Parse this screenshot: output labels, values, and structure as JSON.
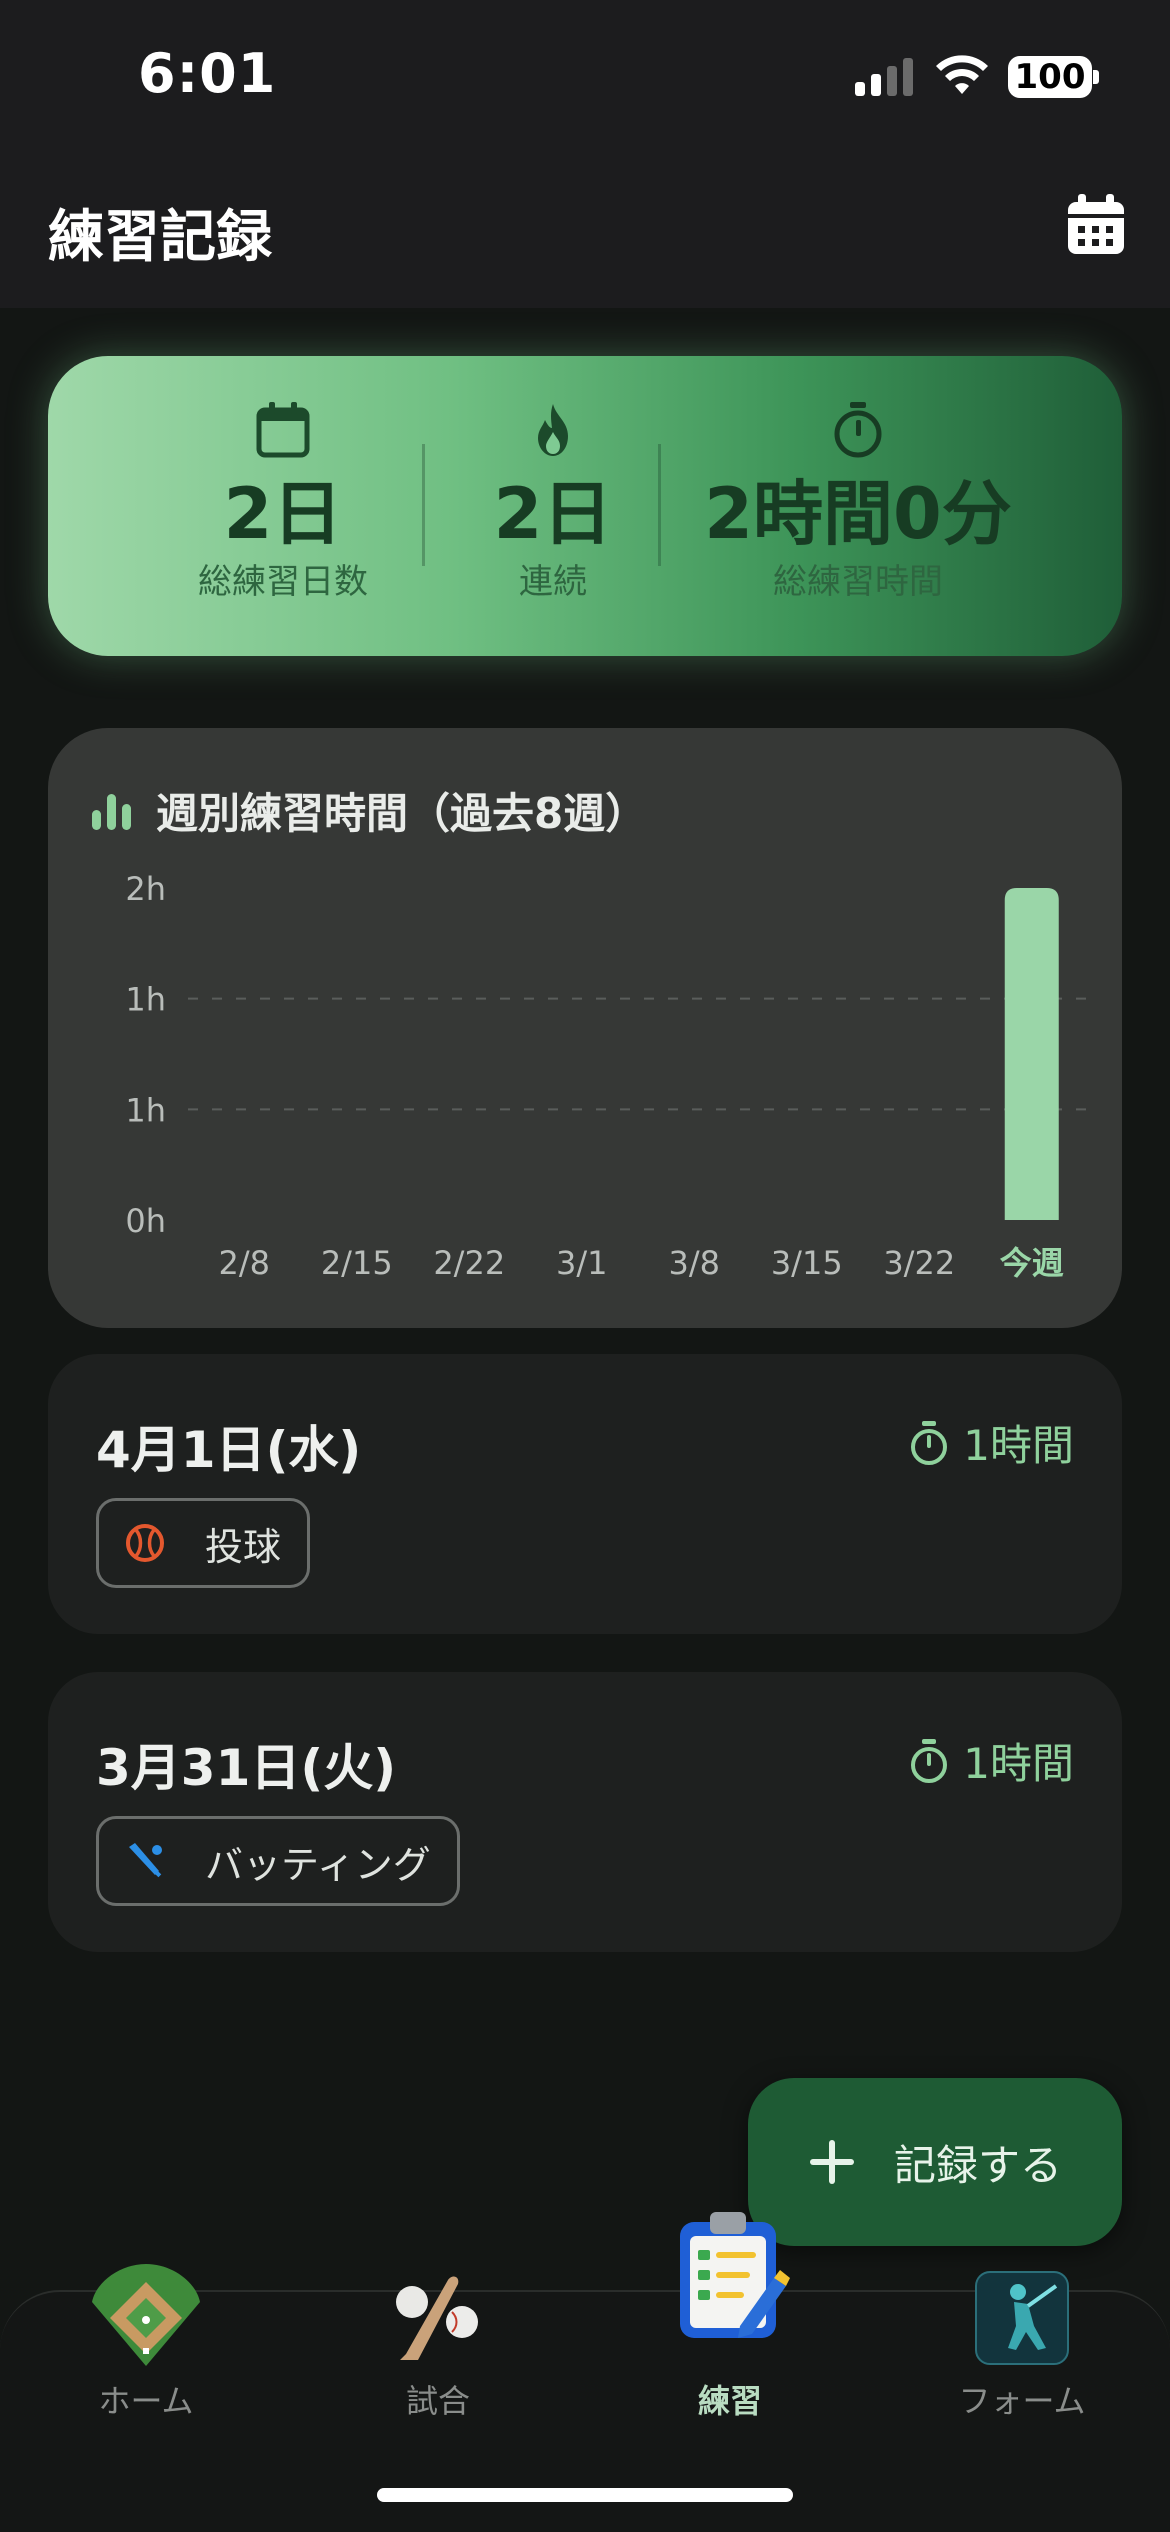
{
  "status_bar": {
    "time": "6:01",
    "battery": "100"
  },
  "header": {
    "title": "練習記録",
    "calendar_icon": "calendar-icon"
  },
  "summary": {
    "stats": [
      {
        "icon": "calendar-icon",
        "value": "2日",
        "label": "総練習日数"
      },
      {
        "icon": "flame-icon",
        "value": "2日",
        "label": "連続"
      },
      {
        "icon": "stopwatch-icon",
        "value": "2時間0分",
        "label": "総練習時間"
      }
    ]
  },
  "chart_data": {
    "type": "bar",
    "title": "週別練習時間（過去8週）",
    "categories": [
      "2/8",
      "2/15",
      "2/22",
      "3/1",
      "3/8",
      "3/15",
      "3/22",
      "今週"
    ],
    "values": [
      0,
      0,
      0,
      0,
      0,
      0,
      0,
      2
    ],
    "unit": "h",
    "ylim": [
      0,
      2
    ],
    "y_ticks": [
      "0h",
      "1h",
      "1h",
      "2h"
    ],
    "grid": "dashed horizontal",
    "bar_color": "#9ad6a8",
    "highlight_category": "今週",
    "highlight_color": "#9ad6a8"
  },
  "sessions": [
    {
      "date": "4月1日(水)",
      "duration": "1時間",
      "tag": {
        "icon": "baseball-icon",
        "label": "投球",
        "color": "#e4582e"
      }
    },
    {
      "date": "3月31日(火)",
      "duration": "1時間",
      "tag": {
        "icon": "bat-icon",
        "label": "バッティング",
        "color": "#2c8fe6"
      }
    }
  ],
  "fab": {
    "icon": "plus-icon",
    "label": "記録する"
  },
  "tabbar": {
    "tabs": [
      {
        "icon": "baseball-field-icon",
        "label": "ホーム",
        "active": false
      },
      {
        "icon": "bat-and-ball-icon",
        "label": "試合",
        "active": false
      },
      {
        "icon": "clipboard-icon",
        "label": "練習",
        "active": true
      },
      {
        "icon": "batter-silhouette-icon",
        "label": "フォーム",
        "active": false
      }
    ]
  }
}
